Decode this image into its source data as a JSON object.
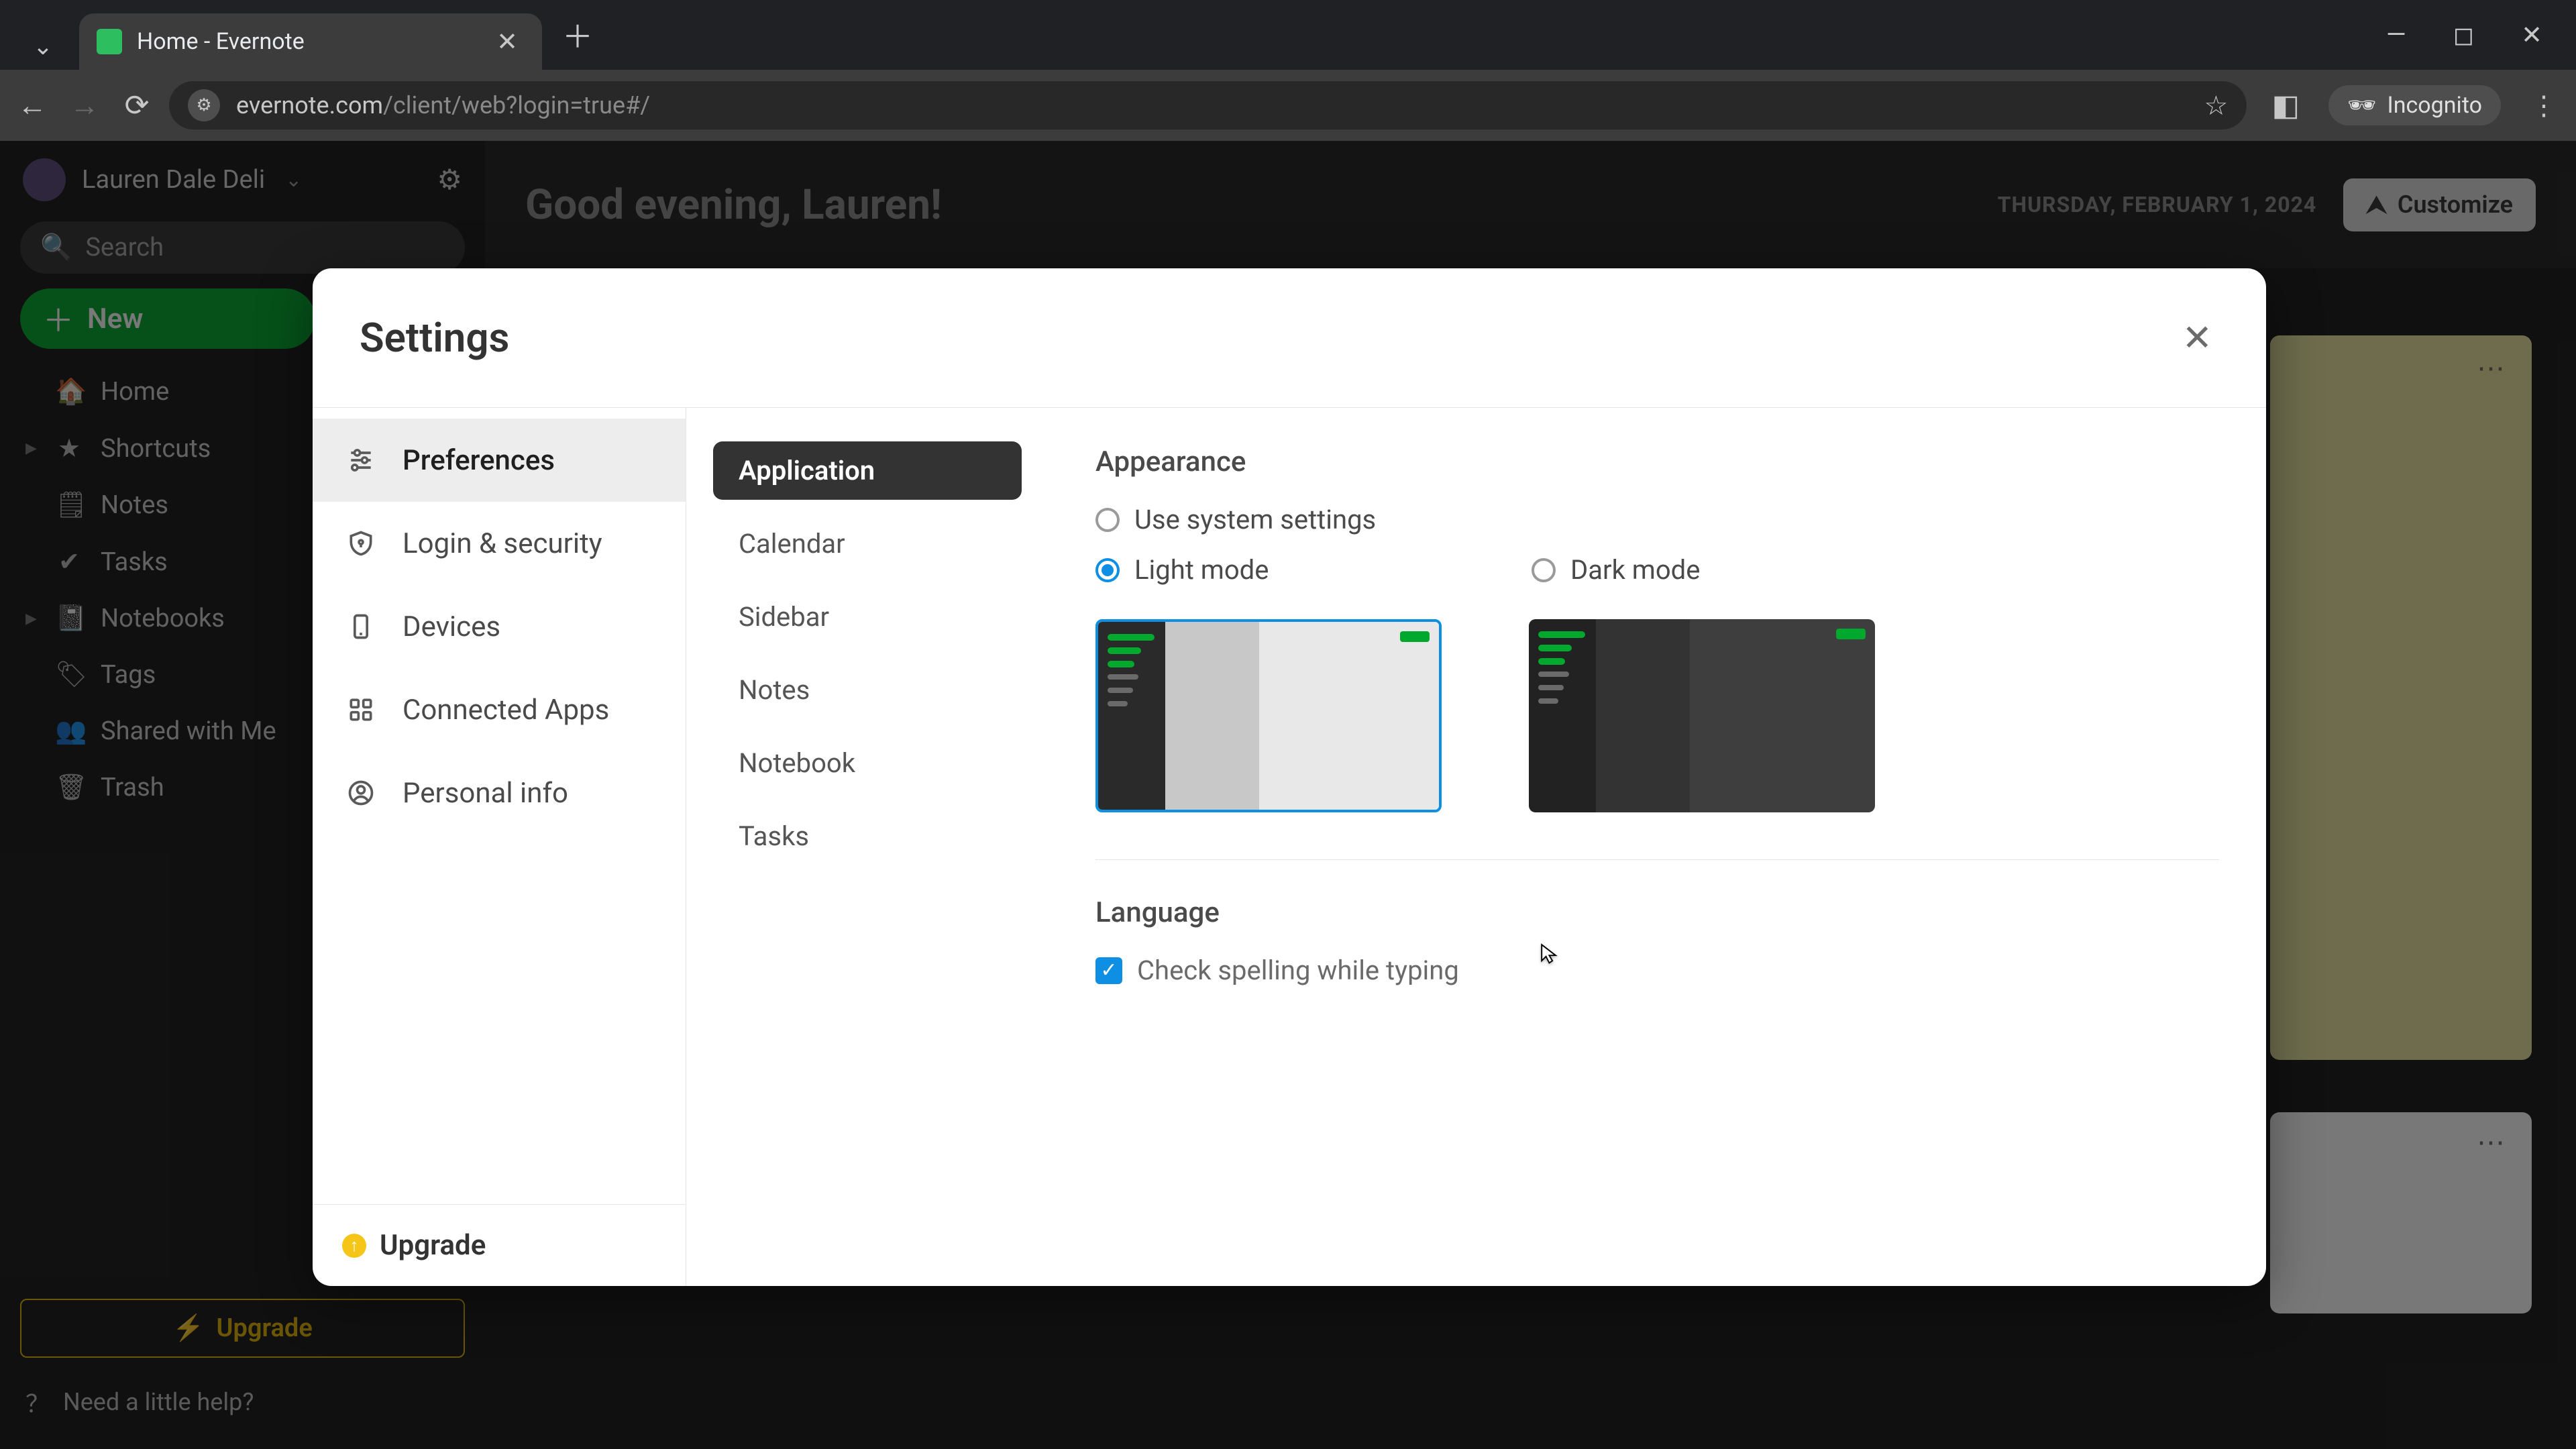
{
  "browser": {
    "tab_title": "Home - Evernote",
    "url_host": "evernote.com",
    "url_path": "/client/web?login=true#/",
    "incognito_label": "Incognito"
  },
  "sidebar": {
    "user_name": "Lauren Dale Deli",
    "search_placeholder": "Search",
    "new_label": "New",
    "items": [
      {
        "label": "Home"
      },
      {
        "label": "Shortcuts"
      },
      {
        "label": "Notes"
      },
      {
        "label": "Tasks"
      },
      {
        "label": "Notebooks"
      },
      {
        "label": "Tags"
      },
      {
        "label": "Shared with Me"
      },
      {
        "label": "Trash"
      }
    ],
    "upgrade_label": "Upgrade",
    "help_label": "Need a little help?"
  },
  "header": {
    "greeting": "Good evening, Lauren!",
    "date": "THURSDAY, FEBRUARY 1, 2024",
    "customize_label": "Customize"
  },
  "settings": {
    "title": "Settings",
    "categories": [
      {
        "label": "Preferences"
      },
      {
        "label": "Login & security"
      },
      {
        "label": "Devices"
      },
      {
        "label": "Connected Apps"
      },
      {
        "label": "Personal info"
      }
    ],
    "upgrade_label": "Upgrade",
    "sub_items": [
      {
        "label": "Application"
      },
      {
        "label": "Calendar"
      },
      {
        "label": "Sidebar"
      },
      {
        "label": "Notes"
      },
      {
        "label": "Notebook"
      },
      {
        "label": "Tasks"
      }
    ],
    "appearance": {
      "title": "Appearance",
      "system_label": "Use system settings",
      "light_label": "Light mode",
      "dark_label": "Dark mode",
      "selected": "light"
    },
    "language": {
      "title": "Language",
      "spellcheck_label": "Check spelling while typing",
      "spellcheck_checked": true
    }
  }
}
